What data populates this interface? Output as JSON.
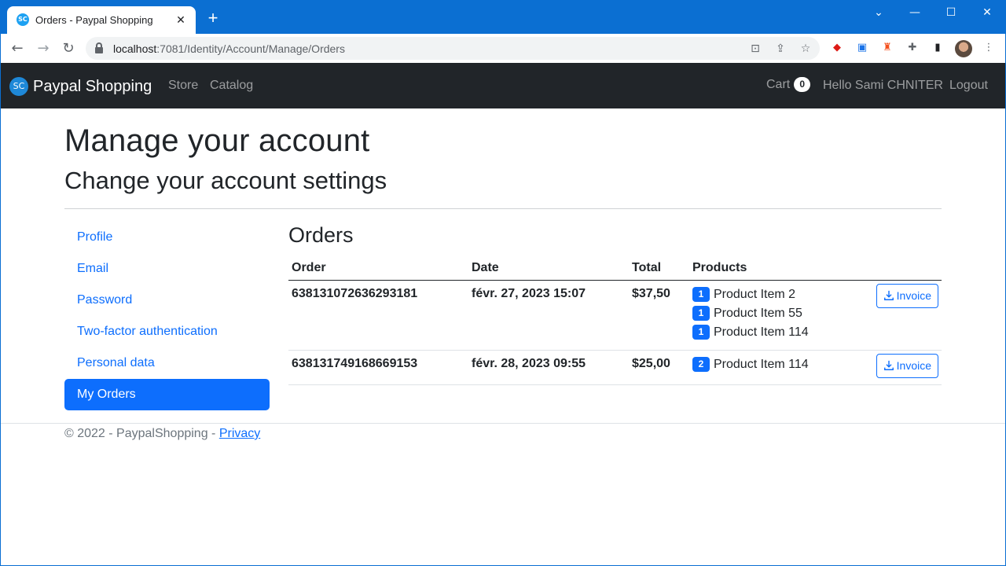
{
  "browser": {
    "tab_title": "Orders - Paypal Shopping",
    "favicon_text": "SC",
    "url_host": "localhost",
    "url_path": ":7081/Identity/Account/Manage/Orders"
  },
  "navbar": {
    "brand_logo": "SC",
    "brand": "Paypal Shopping",
    "links": [
      "Store",
      "Catalog"
    ],
    "cart_label": "Cart",
    "cart_count": "0",
    "greeting": "Hello Sami CHNITER",
    "logout": "Logout"
  },
  "header": {
    "title": "Manage your account",
    "subtitle": "Change your account settings"
  },
  "sidebar": {
    "items": [
      {
        "label": "Profile"
      },
      {
        "label": "Email"
      },
      {
        "label": "Password"
      },
      {
        "label": "Two-factor authentication"
      },
      {
        "label": "Personal data"
      },
      {
        "label": "My Orders",
        "active": true
      }
    ]
  },
  "orders": {
    "title": "Orders",
    "columns": [
      "Order",
      "Date",
      "Total",
      "Products"
    ],
    "invoice_label": "Invoice",
    "rows": [
      {
        "id": "638131072636293181",
        "date": "févr. 27, 2023 15:07",
        "total": "$37,50",
        "products": [
          {
            "qty": "1",
            "name": "Product Item 2"
          },
          {
            "qty": "1",
            "name": "Product Item 55"
          },
          {
            "qty": "1",
            "name": "Product Item 114"
          }
        ]
      },
      {
        "id": "638131749168669153",
        "date": "févr. 28, 2023 09:55",
        "total": "$25,00",
        "products": [
          {
            "qty": "2",
            "name": "Product Item 114"
          }
        ]
      }
    ]
  },
  "footer": {
    "text": "© 2022 - PaypalShopping - ",
    "privacy": "Privacy"
  },
  "colors": {
    "primary": "#0d6efd",
    "navbar_bg": "#212529",
    "browser_frame": "#0b6fd2"
  }
}
